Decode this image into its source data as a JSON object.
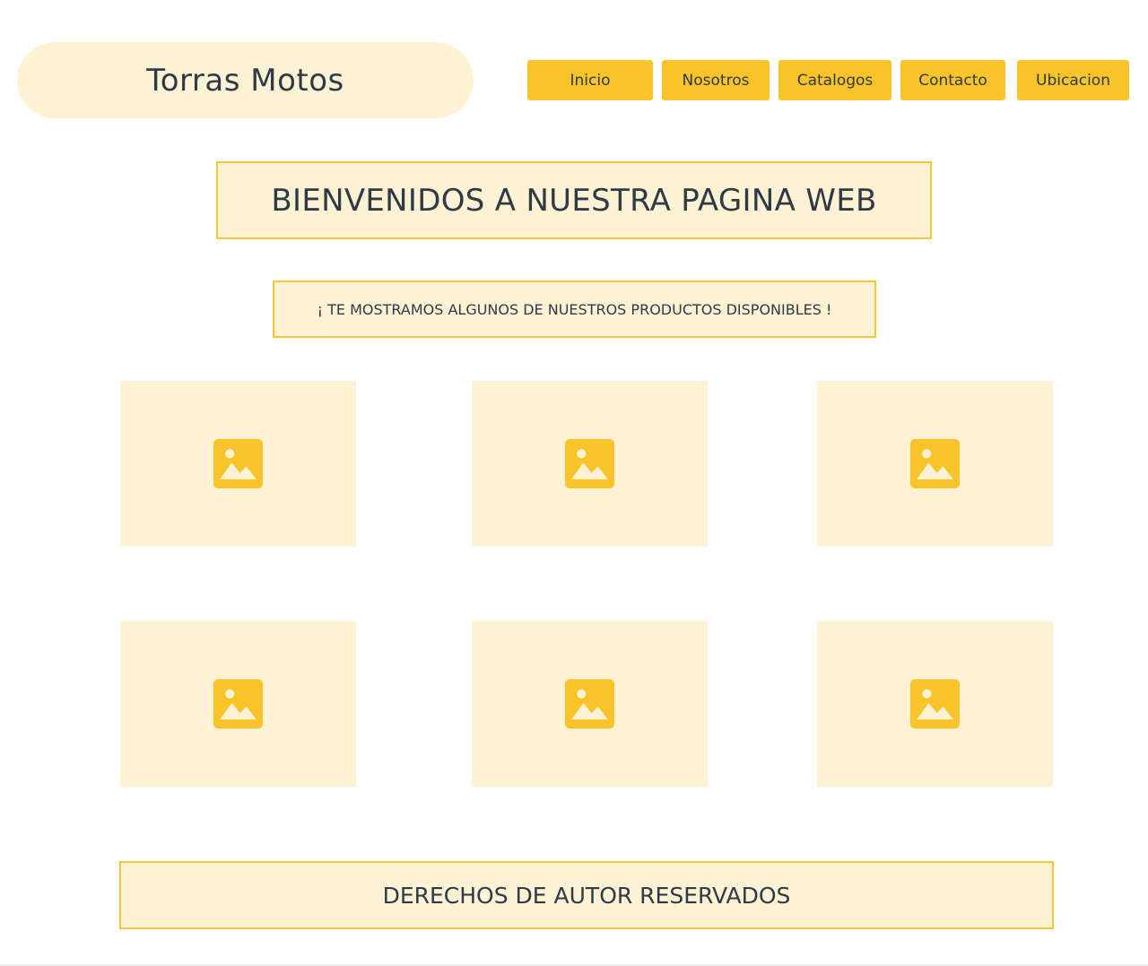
{
  "header": {
    "brand": "Torras Motos",
    "nav": [
      "Inicio",
      "Nosotros",
      "Catalogos",
      "Contacto",
      "Ubicacion"
    ]
  },
  "main": {
    "title": "BIENVENIDOS A NUESTRA PAGINA WEB",
    "subtitle": "¡ TE MOSTRAMOS ALGUNOS DE NUESTROS PRODUCTOS DISPONIBLES !",
    "products": [
      {
        "icon": "image-placeholder-icon"
      },
      {
        "icon": "image-placeholder-icon"
      },
      {
        "icon": "image-placeholder-icon"
      },
      {
        "icon": "image-placeholder-icon"
      },
      {
        "icon": "image-placeholder-icon"
      },
      {
        "icon": "image-placeholder-icon"
      }
    ]
  },
  "footer": {
    "text": "DERECHOS DE AUTOR RESERVADOS"
  },
  "colors": {
    "accent": "#f8c42a",
    "panel": "#fdf2d3",
    "border": "#f5c734",
    "text": "#2e3a46"
  }
}
